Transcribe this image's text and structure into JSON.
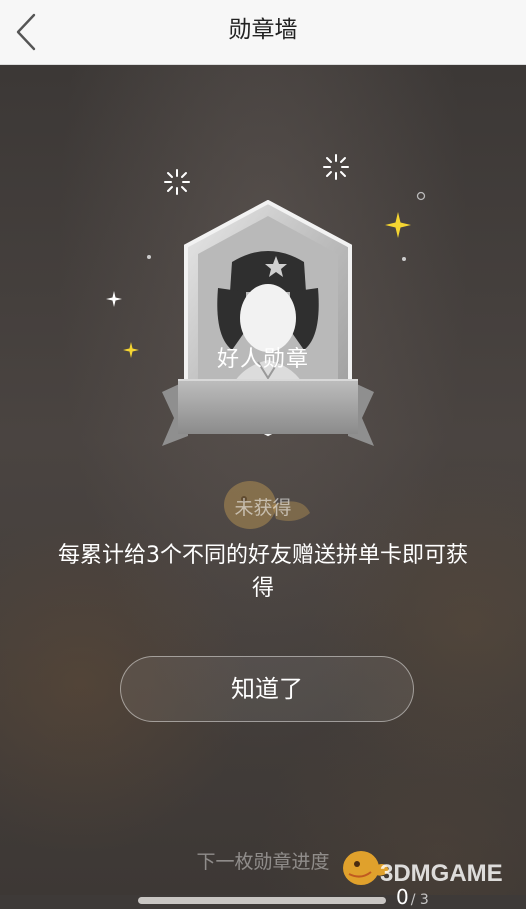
{
  "header": {
    "title": "勋章墙",
    "back_icon": "chevron-left-icon"
  },
  "badge": {
    "name": "好人勋章",
    "status": "未获得",
    "description": "每累计给3个不同的好友赠送拼单卡即可获得"
  },
  "actions": {
    "ok_label": "知道了"
  },
  "progress": {
    "label": "下一枚勋章进度",
    "current": "0",
    "total_text": "/ 3",
    "fraction": 0
  },
  "watermark": {
    "text": "3DMGAME"
  },
  "colors": {
    "sparkle": "#f5d531",
    "progress_track": "#c9c6c3"
  }
}
